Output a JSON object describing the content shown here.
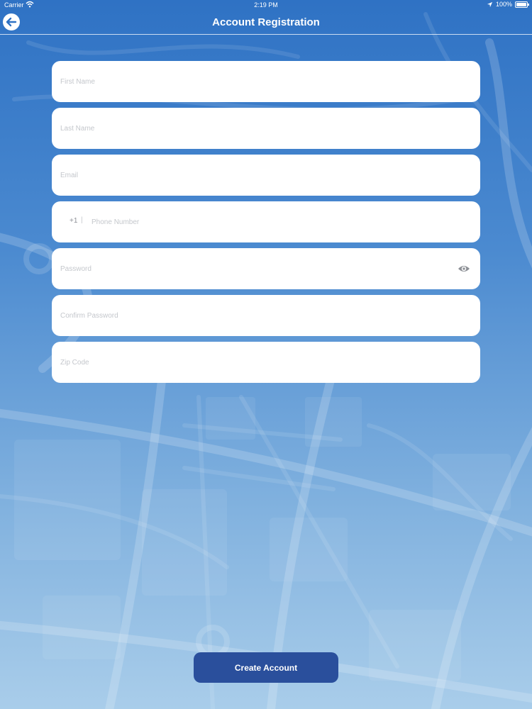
{
  "status_bar": {
    "carrier": "Carrier",
    "time": "2:19 PM",
    "battery": "100%",
    "battery_level": 1.0
  },
  "nav": {
    "title": "Account Registration",
    "back_icon": "back-arrow-icon"
  },
  "form": {
    "first_name": {
      "placeholder": "First Name",
      "value": ""
    },
    "last_name": {
      "placeholder": "Last Name",
      "value": ""
    },
    "email": {
      "placeholder": "Email",
      "value": ""
    },
    "phone": {
      "country_code": "+1",
      "separator": "|",
      "placeholder": "Phone Number",
      "value": ""
    },
    "password": {
      "placeholder": "Password",
      "value": "",
      "toggle_icon": "eye-icon"
    },
    "confirm_password": {
      "placeholder": "Confirm Password",
      "value": ""
    },
    "zip_code": {
      "placeholder": "Zip Code",
      "value": ""
    }
  },
  "actions": {
    "create_account_label": "Create Account"
  },
  "colors": {
    "background_top": "#2f72c4",
    "background_bottom": "#a9cdea",
    "button": "#2a4f9c",
    "field_background": "#ffffff",
    "placeholder": "#c4c7cc"
  }
}
